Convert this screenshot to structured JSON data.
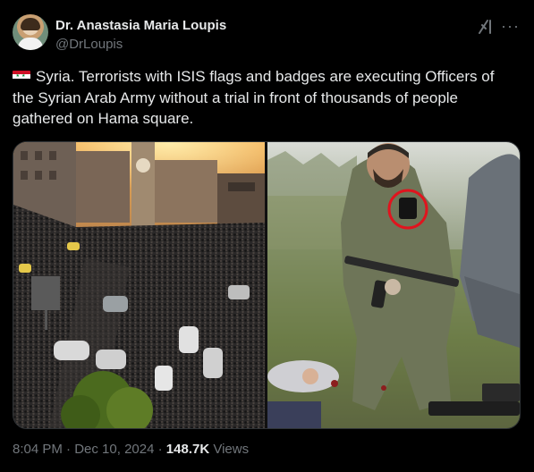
{
  "author": {
    "name": "Dr. Anastasia Maria Loupis",
    "handle": "@DrLoupis"
  },
  "icons": {
    "avatar": "profile-photo",
    "grok": "grok-icon",
    "more": "more-options-icon",
    "flag": "syria-flag-emoji"
  },
  "tweet": {
    "text": "Syria. Terrorists with ISIS flags and badges are executing Officers of the Syrian Arab Army without a trial in front of thousands of people gathered on Hama square."
  },
  "media": {
    "count": 2,
    "items": [
      "crowd-in-square-photo",
      "armed-fighter-with-badge-photo"
    ]
  },
  "meta": {
    "time": "8:04 PM",
    "separator1": " · ",
    "date": "Dec 10, 2024",
    "separator2": " · ",
    "views_count": "148.7K",
    "views_label": " Views"
  },
  "colors": {
    "background": "#000000",
    "text_primary": "#e7e9ea",
    "text_secondary": "#71767b",
    "badge_highlight": "#e0141e"
  }
}
